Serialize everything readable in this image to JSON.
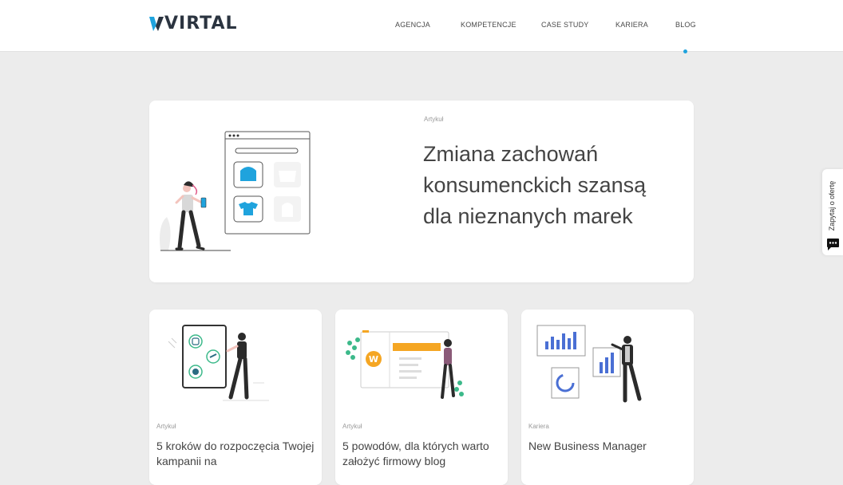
{
  "header": {
    "logo_text": "VIRTAL",
    "nav": [
      "AGENCJA",
      "KOMPETENCJE",
      "CASE STUDY",
      "KARIERA",
      "BLOG"
    ],
    "active_nav": "BLOG"
  },
  "featured": {
    "category": "Artykuł",
    "title": "Zmiana zachowań konsumenckich szansą dla nieznanych marek"
  },
  "posts": [
    {
      "category": "Artykuł",
      "title": "5 kroków do rozpoczęcia Twojej kampanii na"
    },
    {
      "category": "Artykuł",
      "title": "5 powodów, dla których warto założyć firmowy blog"
    },
    {
      "category": "Kariera",
      "title": "New Business Manager"
    }
  ],
  "side_tab": {
    "label": "Zapytaj o ofertę"
  },
  "colors": {
    "accent": "#1fa3dd",
    "background": "#ececec",
    "text": "#444444",
    "illustration_orange": "#f5a623",
    "illustration_green": "#3cb98a"
  }
}
